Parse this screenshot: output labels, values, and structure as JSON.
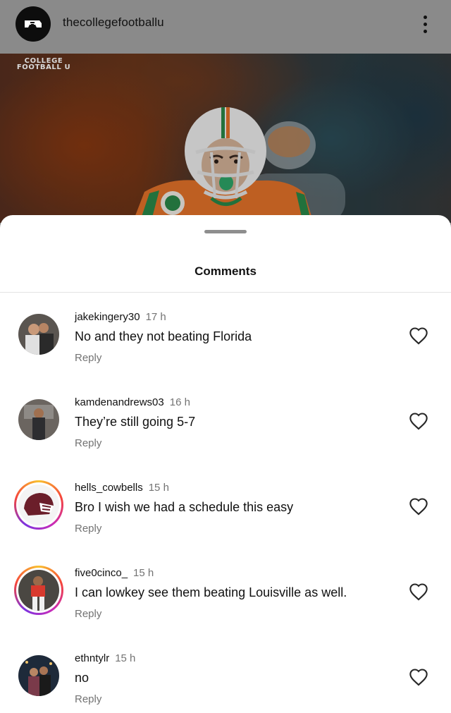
{
  "post": {
    "username": "thecollegefootballu",
    "brand_text": "COLLEGE\nFOOTBALL U",
    "avatar_icon": "cfu-logo-icon",
    "more_icon": "more-vertical-icon"
  },
  "comments_sheet": {
    "title": "Comments",
    "reply_label": "Reply",
    "like_icon": "heart-outline-icon",
    "items": [
      {
        "username": "jakekingery30",
        "time": "17 h",
        "text": "No and they not beating Florida",
        "story_ring": false
      },
      {
        "username": "kamdenandrews03",
        "time": "16 h",
        "text": "They’re still going 5-7",
        "story_ring": false
      },
      {
        "username": "hells_cowbells",
        "time": "15 h",
        "text": "Bro I wish we had a schedule this easy",
        "story_ring": true
      },
      {
        "username": "five0cinco_",
        "time": "15 h",
        "text": "I can lowkey see them beating Louisville as well.",
        "story_ring": true
      },
      {
        "username": "ethntylr",
        "time": "15 h",
        "text": "no",
        "story_ring": false
      }
    ]
  },
  "colors": {
    "header_bg": "#8a8a8a",
    "secondary_text": "#737373",
    "story_ring_start": "#f9c12e",
    "story_ring_end": "#c92bb7"
  }
}
